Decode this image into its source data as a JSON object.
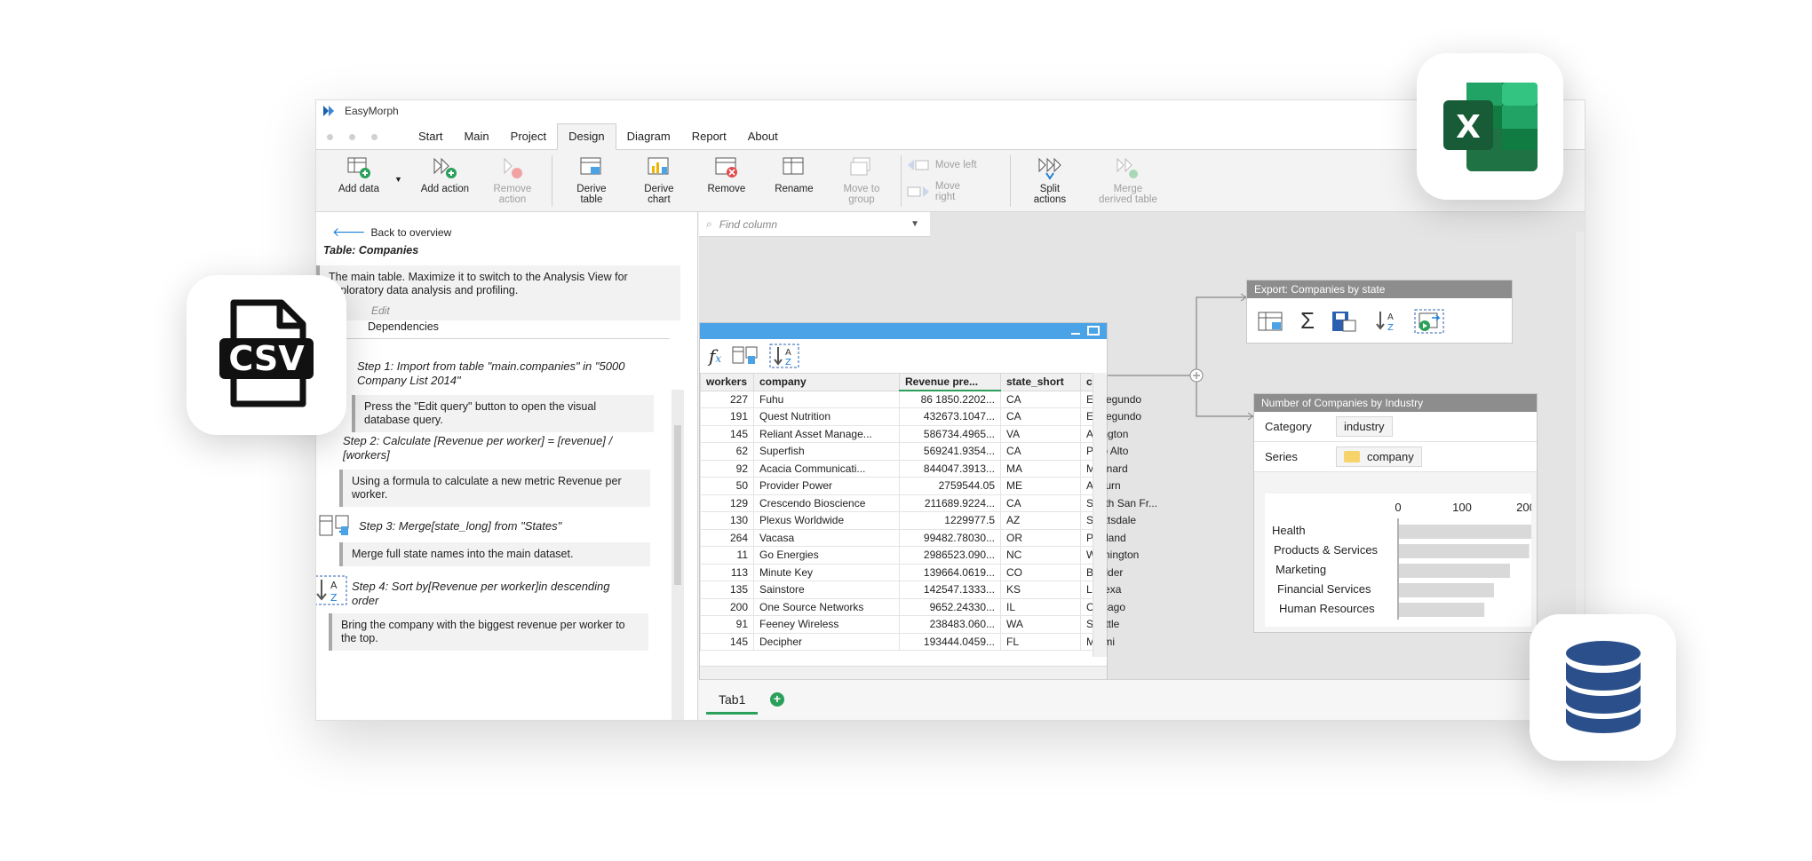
{
  "app": {
    "title": "EasyMorph"
  },
  "menu_tabs": [
    "Start",
    "Main",
    "Project",
    "Design",
    "Diagram",
    "Report",
    "About"
  ],
  "ribbon": {
    "add_data": "Add data",
    "add_action": "Add action",
    "remove_action": "Remove\naction",
    "derive_table": "Derive\ntable",
    "derive_chart": "Derive\nchart",
    "remove": "Remove",
    "rename": "Rename",
    "move_to_group": "Move to\ngroup",
    "move_left": "Move left",
    "move_right": "Move\nright",
    "split_actions": "Split\nactions",
    "merge_derived": "Merge\nderived table"
  },
  "left": {
    "back": "Back to overview",
    "table_title": "Table: Companies",
    "description": "The main table. Maximize it to switch to the Analysis View for exploratory data analysis and profiling.",
    "edit": "Edit",
    "dependencies": "Dependencies",
    "steps": [
      {
        "title": "Step 1: Import from table \"main.companies\" in \"5000 Company List 2014\"",
        "note": "Press the \"Edit query\" button to open the visual database query."
      },
      {
        "title": "Step 2: Calculate [Revenue per worker] = [revenue] / [workers]",
        "note": "Using a formula to calculate a new metric Revenue per worker."
      },
      {
        "title": "Step 3: Merge[state_long] from \"States\"",
        "note": "Merge full state names into the main dataset."
      },
      {
        "title": "Step 4: Sort by[Revenue per worker]in descending order",
        "note": "Bring the company with the biggest revenue per worker to the top."
      }
    ]
  },
  "find": {
    "placeholder": "Find column"
  },
  "table": {
    "columns": [
      "workers",
      "company",
      "Revenue pre...",
      "state_short",
      "city"
    ],
    "rows": [
      [
        "227",
        "Fuhu",
        "86 1850.2202...",
        "CA",
        "El Segundo"
      ],
      [
        "191",
        "Quest Nutrition",
        "432673.1047...",
        "CA",
        "El Segundo"
      ],
      [
        "145",
        "Reliant Asset Manage...",
        "586734.4965...",
        "VA",
        "Arlington"
      ],
      [
        "62",
        "Superfish",
        "569241.9354...",
        "CA",
        "Palo Alto"
      ],
      [
        "92",
        "Acacia Communicati...",
        "844047.3913...",
        "MA",
        "Maynard"
      ],
      [
        "50",
        "Provider Power",
        "2759544.05",
        "ME",
        "Auburn"
      ],
      [
        "129",
        "Crescendo Bioscience",
        "211689.9224...",
        "CA",
        "South San Fr..."
      ],
      [
        "130",
        "Plexus Worldwide",
        "1229977.5",
        "AZ",
        "Scottsdale"
      ],
      [
        "264",
        "Vacasa",
        "99482.78030...",
        "OR",
        "Portland"
      ],
      [
        "11",
        "Go Energies",
        "2986523.090...",
        "NC",
        "Wilmington"
      ],
      [
        "113",
        "Minute Key",
        "139664.0619...",
        "CO",
        "Boulder"
      ],
      [
        "135",
        "Sainstore",
        "142547.1333...",
        "KS",
        "Lenexa"
      ],
      [
        "200",
        "One Source Networks",
        "9652.24330...",
        "IL",
        "Chicago"
      ],
      [
        "91",
        "Feeney Wireless",
        "238483.060...",
        "WA",
        "Seattle"
      ],
      [
        "145",
        "Decipher",
        "193444.0459...",
        "FL",
        "Miami"
      ]
    ]
  },
  "export_panel": {
    "title": "Export:  Companies by state"
  },
  "chart_panel": {
    "title": "Number of Companies by Industry",
    "category_label": "Category",
    "category_value": "industry",
    "series_label": "Series",
    "series_value": "company"
  },
  "chart_data": {
    "type": "bar",
    "orientation": "horizontal",
    "categories": [
      "Health",
      "Products & Services",
      "Marketing",
      "Financial Services",
      "Human Resources"
    ],
    "values": [
      210,
      205,
      175,
      150,
      135
    ],
    "xticks": [
      "0",
      "100",
      "200"
    ],
    "xlim": [
      0,
      200
    ],
    "grid": false
  },
  "sheet_tab": "Tab1",
  "badges": {
    "csv": "CSV",
    "excel": "X"
  },
  "colors": {
    "accent": "#4aa3e6",
    "green": "#2aa05a",
    "db": "#2b4f8a",
    "excel": "#1f7244"
  }
}
